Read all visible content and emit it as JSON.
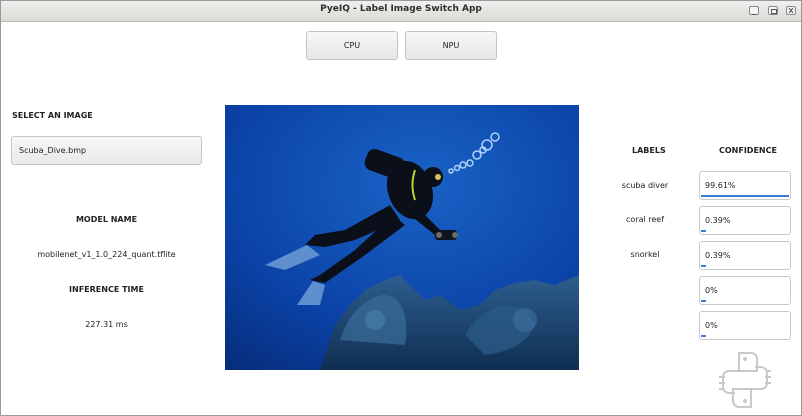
{
  "window": {
    "title": "PyeIQ - Label Image Switch App"
  },
  "toolbar": {
    "cpu_label": "CPU",
    "npu_label": "NPU"
  },
  "left_panel": {
    "select_heading": "SELECT AN IMAGE",
    "selected_image": "Scuba_Dive.bmp",
    "model_heading": "MODEL NAME",
    "model_name": "mobilenet_v1_1.0_224_quant.tflite",
    "inference_heading": "INFERENCE TIME",
    "inference_time": "227.31 ms"
  },
  "results": {
    "labels_heading": "LABELS",
    "confidence_heading": "CONFIDENCE",
    "rows": [
      {
        "label": "scuba diver",
        "confidence": "99.61%",
        "fraction": 0.9961
      },
      {
        "label": "coral reef",
        "confidence": "0.39%",
        "fraction": 0.0039
      },
      {
        "label": "snorkel",
        "confidence": "0.39%",
        "fraction": 0.0039
      },
      {
        "label": "",
        "confidence": "0%",
        "fraction": 0
      },
      {
        "label": "",
        "confidence": "0%",
        "fraction": 0
      }
    ]
  },
  "colors": {
    "accent": "#3a7bd5",
    "water": "#0b3f9e"
  },
  "icons": {
    "logo": "python-chip-logo-icon"
  }
}
